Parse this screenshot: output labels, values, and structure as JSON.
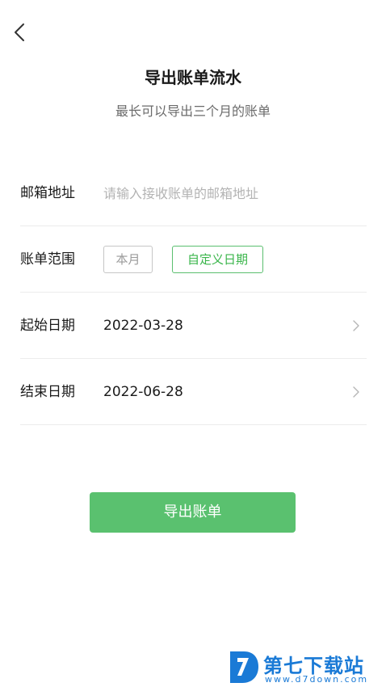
{
  "header": {
    "back_icon": "chevron-left-icon",
    "title": "导出账单流水",
    "subtitle": "最长可以导出三个月的账单"
  },
  "form": {
    "email": {
      "label": "邮箱地址",
      "placeholder": "请输入接收账单的邮箱地址",
      "value": ""
    },
    "range": {
      "label": "账单范围",
      "options": [
        "本月",
        "自定义日期"
      ],
      "selected": "自定义日期"
    },
    "start_date": {
      "label": "起始日期",
      "value": "2022-03-28",
      "icon": "chevron-right-icon"
    },
    "end_date": {
      "label": "结束日期",
      "value": "2022-06-28",
      "icon": "chevron-right-icon"
    }
  },
  "actions": {
    "export_label": "导出账单"
  },
  "watermark": {
    "brand": "第七下载站",
    "url": "www.d7down.com",
    "icon": "d7-logo-icon"
  },
  "colors": {
    "accent": "#5ac16f",
    "accent_text": "#39b54a",
    "watermark": "#1a7ad6"
  }
}
